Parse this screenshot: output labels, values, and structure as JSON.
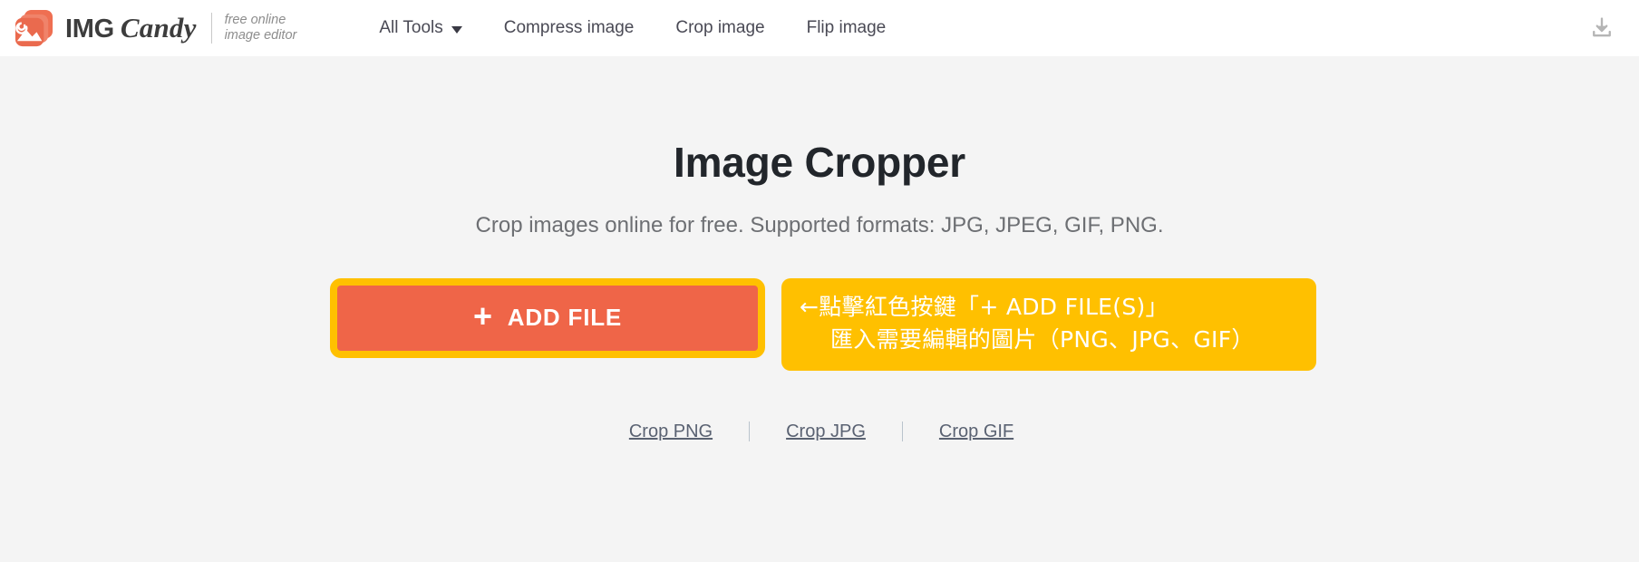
{
  "header": {
    "brand": {
      "icon": "img-candy-photo-icon",
      "name_primary": "IMG",
      "name_secondary": "Candy",
      "tagline_line1": "free online",
      "tagline_line2": "image editor"
    },
    "nav_items": [
      {
        "label": "All Tools",
        "has_caret": true,
        "name": "nav-all-tools"
      },
      {
        "label": "Compress image",
        "has_caret": false,
        "name": "nav-compress-image"
      },
      {
        "label": "Crop image",
        "has_caret": false,
        "name": "nav-crop-image"
      },
      {
        "label": "Flip image",
        "has_caret": false,
        "name": "nav-flip-image"
      }
    ],
    "download_icon": "download-icon"
  },
  "main": {
    "title": "Image Cropper",
    "subtitle": "Crop images online for free. Supported formats: JPG, JPEG, GIF, PNG.",
    "add_file_button": {
      "plus": "+",
      "label": "ADD FILE"
    },
    "annotation": {
      "line1": "←點擊紅色按鍵「+ ADD FILE(S)」",
      "line2": "匯入需要編輯的圖片（PNG、JPG、GIF）"
    },
    "links": [
      {
        "label": "Crop PNG",
        "name": "link-crop-png"
      },
      {
        "label": "Crop JPG",
        "name": "link-crop-jpg"
      },
      {
        "label": "Crop GIF",
        "name": "link-crop-gif"
      }
    ]
  },
  "colors": {
    "accent_coral": "#ef6548",
    "accent_yellow": "#ffc000",
    "page_background": "#f4f4f4",
    "header_background": "#ffffff",
    "title_text": "#22262b",
    "subtitle_text": "#6d6f73",
    "link_text": "#5a6272"
  }
}
